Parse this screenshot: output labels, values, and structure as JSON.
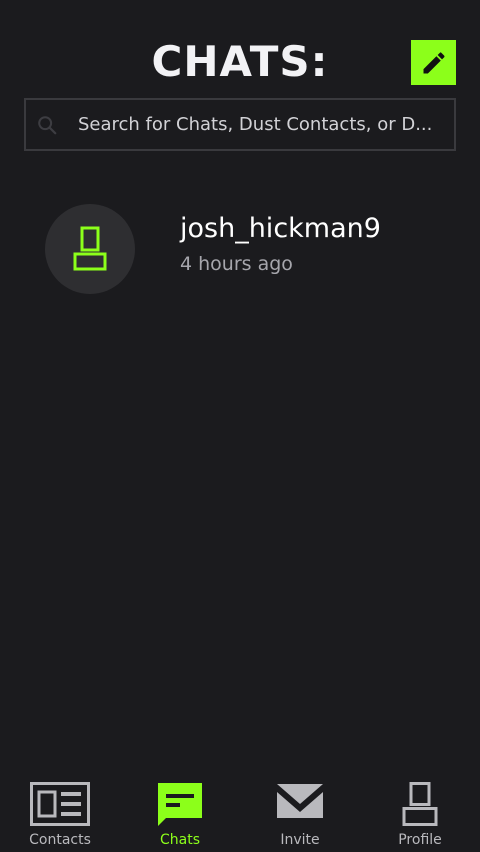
{
  "header": {
    "title": "CHATS:",
    "compose_icon": "pencil-icon"
  },
  "search": {
    "placeholder": "Search for Chats, Dust Contacts, or D...",
    "value": "",
    "icon": "search-icon"
  },
  "chats": [
    {
      "name": "josh_hickman9",
      "time": "4 hours ago",
      "avatar_icon": "user-icon"
    }
  ],
  "nav": {
    "items": [
      {
        "label": "Contacts",
        "icon": "contacts-card-icon",
        "active": false
      },
      {
        "label": "Chats",
        "icon": "chat-bubble-icon",
        "active": true
      },
      {
        "label": "Invite",
        "icon": "envelope-icon",
        "active": false
      },
      {
        "label": "Profile",
        "icon": "user-icon",
        "active": false
      }
    ]
  },
  "colors": {
    "background": "#1b1b1e",
    "accent": "#8cff1a",
    "inactive": "#b9b9bd",
    "avatar_bg": "#2e2e31"
  }
}
